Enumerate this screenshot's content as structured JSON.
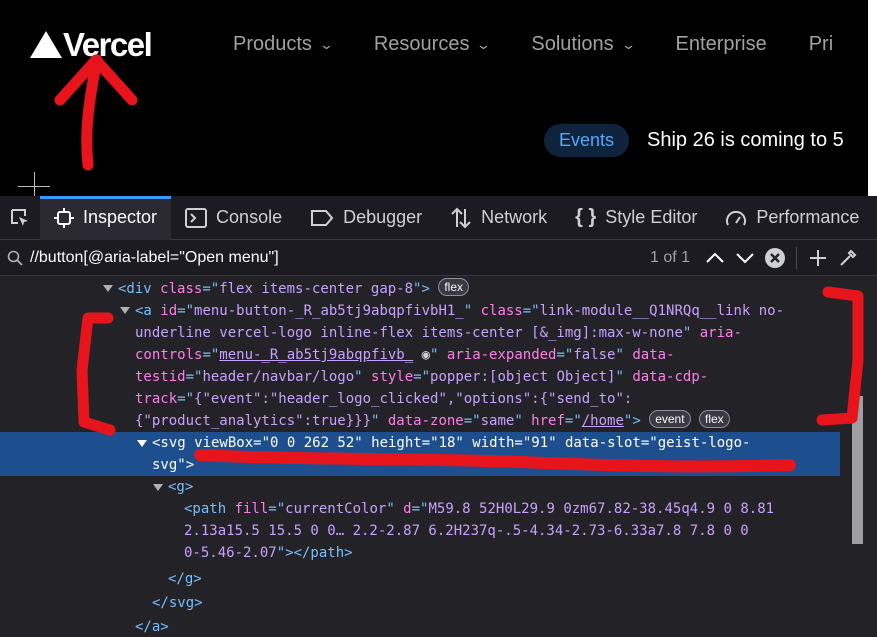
{
  "site": {
    "logo_text": "Vercel",
    "nav": [
      {
        "label": "Products",
        "has_dropdown": true
      },
      {
        "label": "Resources",
        "has_dropdown": true
      },
      {
        "label": "Solutions",
        "has_dropdown": true
      },
      {
        "label": "Enterprise",
        "has_dropdown": false
      },
      {
        "label": "Pri",
        "has_dropdown": false
      }
    ],
    "events_pill": "Events",
    "announcement": "Ship 26 is coming to 5"
  },
  "devtools": {
    "tabs": [
      {
        "label": "Inspector",
        "icon": "inspector-icon",
        "selected": true
      },
      {
        "label": "Console",
        "icon": "console-icon"
      },
      {
        "label": "Debugger",
        "icon": "debugger-icon"
      },
      {
        "label": "Network",
        "icon": "network-icon"
      },
      {
        "label": "Style Editor",
        "icon": "style-editor-icon"
      },
      {
        "label": "Performance",
        "icon": "performance-icon"
      }
    ],
    "search": {
      "value": "//button[@aria-label=\"Open menu\"]",
      "count": "1 of 1"
    },
    "markup": {
      "div_open": {
        "tag": "div",
        "attr": "class",
        "value": "flex items-center gap-8",
        "badge": "flex"
      },
      "a_lines": [
        [
          "<a ",
          [
            "id",
            "menu-button-_R_ab5tj9abqpfivbH1_"
          ],
          " ",
          [
            "class",
            "link-module__Q1NRQq__link no-"
          ]
        ],
        [
          "underline vercel-logo inline-flex items-center [&_img]:max-w-none",
          null,
          "\" aria-"
        ],
        [
          "controls=\"menu-_R_ab5tj9abqpfivb_\" aria-expanded=\"false\" data-"
        ],
        [
          "testid=\"header/navbar/logo\" style=\"popper:[object Object]\" data-cdp-"
        ],
        [
          "track=\"{\"event\":\"header_logo_clicked\",\"options\":{\"send_to\":"
        ],
        [
          "{\"product_analytics\":true}}}\" data-zone=\"same\" href=\"/home\">"
        ]
      ],
      "a_badges": [
        "event",
        "flex"
      ],
      "svg_line1": "<svg viewBox=\"0 0 262 52\" height=\"18\" width=\"91\" data-slot=\"geist-logo-",
      "svg_line2": "svg\">",
      "g_open": "<g>",
      "path_line1": "<path fill=\"currentColor\" d=\"M59.8 52H0L29.9 0zm67.82-38.45q4.9 0 8.81",
      "path_line2": "2.13a15.5 15.5 0 0… 2.2-2.87 6.2H237q-.5-4.34-2.73-6.33a7.8 7.8 0 0",
      "path_line3": "0-5.46-2.07\"></path>",
      "g_close": "</g>",
      "svg_close": "</svg>",
      "a_close": "</a>"
    }
  },
  "colors": {
    "annotation": "#e8141b",
    "selection": "#1d4f8f",
    "tag": "#75bfff",
    "attr_name": "#ff7de9",
    "attr_value": "#c7a0ff"
  }
}
